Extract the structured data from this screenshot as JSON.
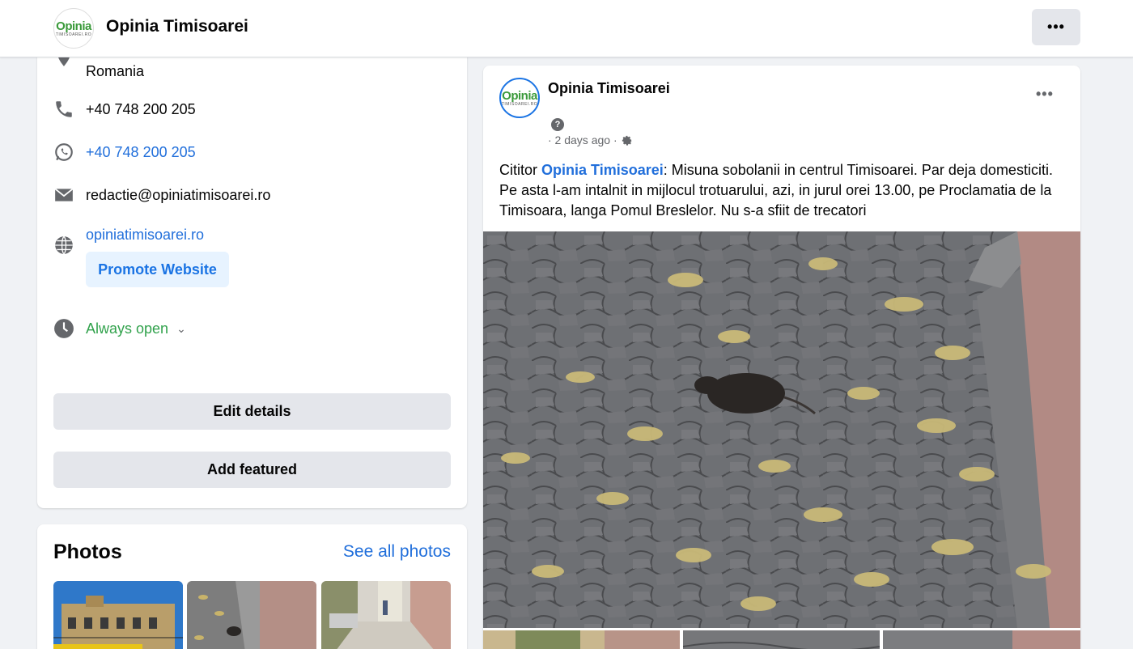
{
  "header": {
    "logo_word": "Opinia",
    "logo_sub": "TIMISOAREI.RO",
    "title": "Opinia Timisoarei",
    "menu_label": "•••"
  },
  "intro": {
    "address_last_line": "Romania",
    "phone": "+40 748 200 205",
    "whatsapp": "+40 748 200 205",
    "email": "redactie@opiniatimisoarei.ro",
    "website": "opiniatimisoarei.ro",
    "promote_label": "Promote Website",
    "hours": "Always open",
    "edit_details_label": "Edit details",
    "add_featured_label": "Add featured"
  },
  "photos": {
    "title": "Photos",
    "see_all_label": "See all photos"
  },
  "post": {
    "author": "Opinia Timisoarei",
    "help": "?",
    "time": "· 2 days ago ·",
    "more_label": "•••",
    "text_prefix": "Cititor ",
    "mention": "Opinia Timisoarei",
    "text_body": ": Misuna sobolanii in centrul Timisoarei. Par deja domesticiti. Pe asta l-am intalnit in mijlocul trotuarului, azi, in jurul orei 13.00, pe Proclamatia de la Timisoara, langa Pomul Breslelor. Nu s-a sfiit de trecatori"
  },
  "colors": {
    "link": "#216fdb",
    "open_green": "#31a24c",
    "button_gray": "#e4e6eb",
    "promote_bg": "#e7f3ff"
  }
}
